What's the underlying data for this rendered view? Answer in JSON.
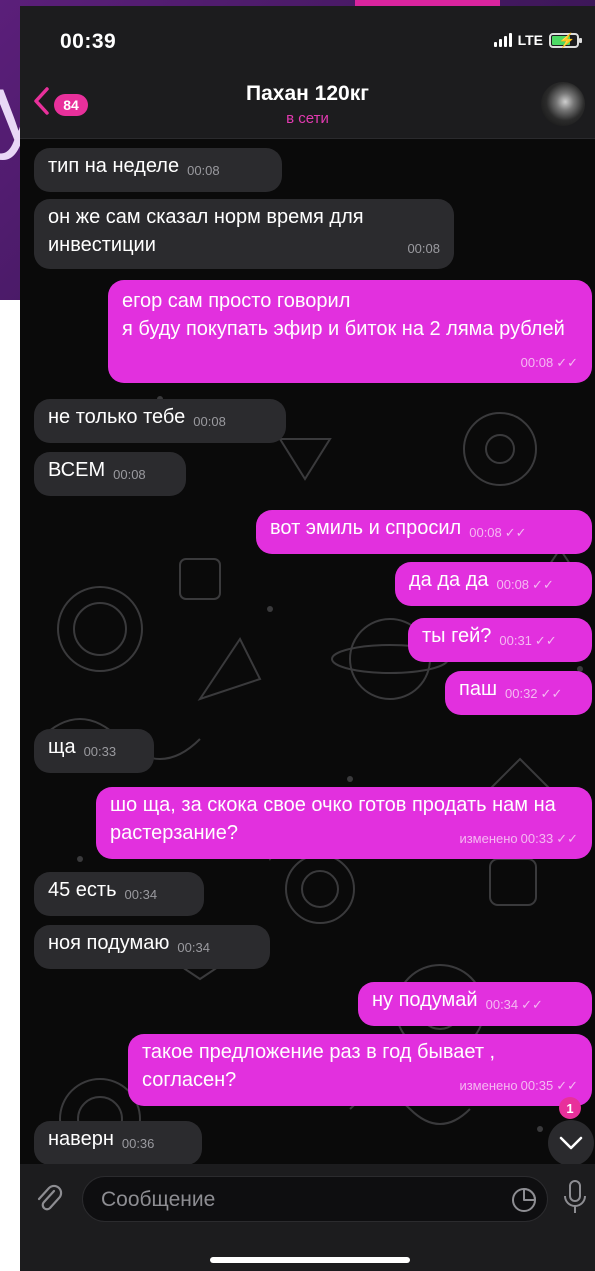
{
  "background": {
    "letter": "у"
  },
  "status_bar": {
    "time": "00:39",
    "network": "LTE"
  },
  "header": {
    "back_badge": "84",
    "title": "Пахан 120кг",
    "status": "в сети"
  },
  "messages": [
    {
      "dir": "in",
      "text": "тип на неделе",
      "time": "00:08"
    },
    {
      "dir": "in",
      "text": "он же сам сказал норм время для инвестиции",
      "time": "00:08"
    },
    {
      "dir": "out",
      "text": "егор сам просто говорил\nя буду покупать эфир и биток на 2 ляма рублей",
      "time": "00:08"
    },
    {
      "dir": "in",
      "text": "не только тебе",
      "time": "00:08"
    },
    {
      "dir": "in",
      "text": "ВСЕМ",
      "time": "00:08"
    },
    {
      "dir": "out",
      "text": "вот эмиль и спросил",
      "time": "00:08"
    },
    {
      "dir": "out",
      "text": "да да да",
      "time": "00:08"
    },
    {
      "dir": "out",
      "text": "ты гей?",
      "time": "00:31"
    },
    {
      "dir": "out",
      "text": "паш",
      "time": "00:32"
    },
    {
      "dir": "in",
      "text": "ща",
      "time": "00:33"
    },
    {
      "dir": "out",
      "text": "шо ща, за скока свое очко готов продать нам на растерзание?",
      "time": "00:33",
      "edited": "изменено"
    },
    {
      "dir": "in",
      "text": "45 есть",
      "time": "00:34"
    },
    {
      "dir": "in",
      "text": "ноя подумаю",
      "time": "00:34"
    },
    {
      "dir": "out",
      "text": "ну подумай",
      "time": "00:34"
    },
    {
      "dir": "out",
      "text": "такое предложение раз в год бывает , согласен?",
      "time": "00:35",
      "edited": "изменено"
    },
    {
      "dir": "in",
      "text": "наверн",
      "time": "00:36"
    }
  ],
  "scroll_down_badge": "1",
  "composer": {
    "placeholder": "Сообщение"
  },
  "colors": {
    "accent": "#e230de",
    "incoming_bubble": "#2b2b2e",
    "badge": "#e8309b",
    "online_status": "#e23ab0"
  }
}
